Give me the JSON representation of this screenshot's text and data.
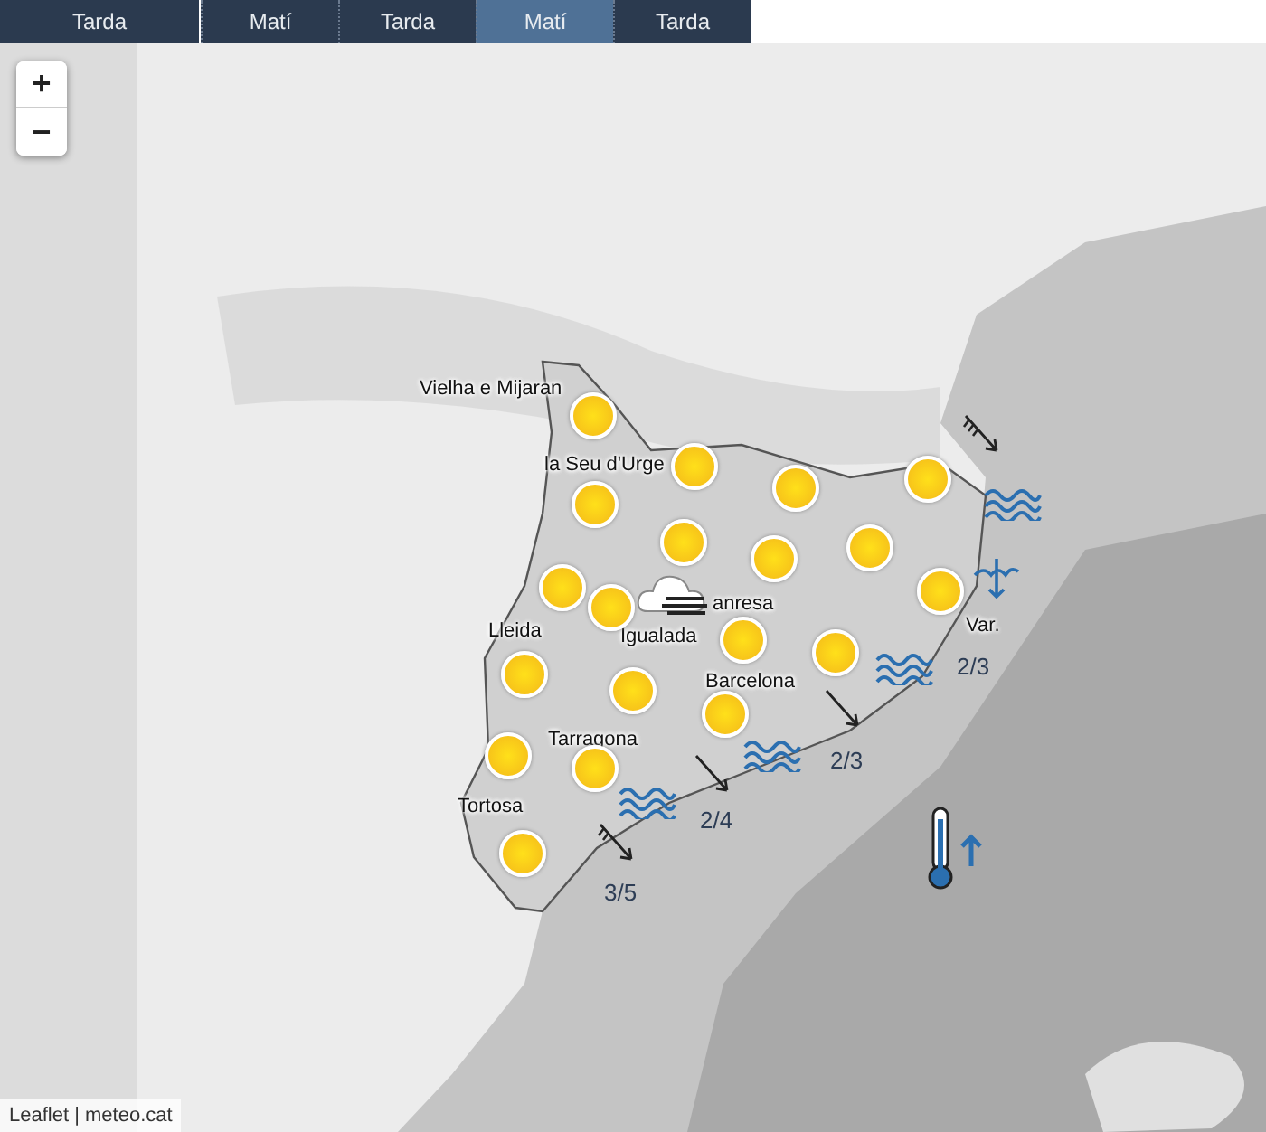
{
  "tabs": [
    {
      "label": "Tarda",
      "selected": false
    },
    {
      "label": "Matí",
      "selected": false
    },
    {
      "label": "Tarda",
      "selected": false
    },
    {
      "label": "Matí",
      "selected": true
    },
    {
      "label": "Tarda",
      "selected": false
    }
  ],
  "zoom_controls": {
    "zoom_in": "+",
    "zoom_out": "−"
  },
  "map": {
    "towns": [
      {
        "name": "Vielha e Mijaran"
      },
      {
        "name": "la Seu d'Urge"
      },
      {
        "name": "anresa"
      },
      {
        "name": "Igualada"
      },
      {
        "name": "Lleida"
      },
      {
        "name": "Barcelona"
      },
      {
        "name": "Tarragona"
      },
      {
        "name": "Tortosa"
      },
      {
        "name": "Var."
      }
    ],
    "weather_markers": [
      {
        "kind": "sun"
      },
      {
        "kind": "sun"
      },
      {
        "kind": "sun"
      },
      {
        "kind": "sun"
      },
      {
        "kind": "sun"
      },
      {
        "kind": "sun"
      },
      {
        "kind": "sun"
      },
      {
        "kind": "sun"
      },
      {
        "kind": "sun"
      },
      {
        "kind": "sun"
      },
      {
        "kind": "sun"
      },
      {
        "kind": "sun"
      },
      {
        "kind": "sun"
      },
      {
        "kind": "sun"
      },
      {
        "kind": "sun"
      },
      {
        "kind": "sun"
      },
      {
        "kind": "sun"
      },
      {
        "kind": "sun"
      },
      {
        "kind": "sun"
      },
      {
        "kind": "cloud-fog"
      }
    ],
    "sea_states": [
      {
        "label": "2/3"
      },
      {
        "label": "2/3"
      },
      {
        "label": "2/4"
      },
      {
        "label": "3/5"
      }
    ]
  },
  "attribution": {
    "links": [
      "Leaflet",
      "meteo.cat"
    ],
    "separator": "|"
  }
}
